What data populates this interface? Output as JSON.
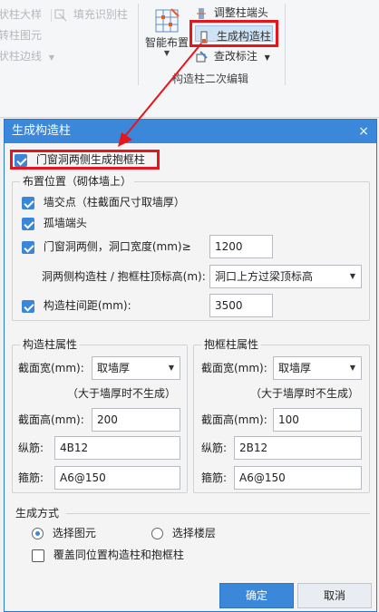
{
  "ribbon": {
    "left_items": [
      "",
      "",
      ""
    ],
    "left_item_suffixes": [
      "状柱大样",
      "转柱图元",
      "状柱边线"
    ],
    "fill_recognize": "填充识别柱",
    "smart_layout": "智能布置",
    "adjust_column_end": "调整柱端头",
    "generate_column": "生成构造柱",
    "modify_annotation": "查改标注",
    "group_label": "构造柱二次编辑"
  },
  "dialog": {
    "title": "生成构造柱",
    "close": "×",
    "door_window_frame": {
      "label": "门窗洞两侧生成抱框柱",
      "checked": true
    },
    "layout_position": {
      "legend": "布置位置（砌体墙上）",
      "wall_intersection": {
        "label": "墙交点（柱截面尺寸取墙厚）",
        "checked": true
      },
      "isolated_wall_end": {
        "label": "孤墙端头",
        "checked": true
      },
      "door_window_sides": {
        "label": "门窗洞两侧，洞口宽度(mm)≥",
        "checked": true,
        "value": "1200"
      },
      "top_elevation": {
        "label": "洞两侧构造柱 / 抱框柱顶标高(m):",
        "value": "洞口上方过梁顶标高"
      },
      "spacing": {
        "label": "构造柱间距(mm):",
        "checked": true,
        "value": "3500"
      }
    },
    "column_props": {
      "legend": "构造柱属性",
      "width_label": "截面宽(mm):",
      "width_value": "取墙厚",
      "note": "（大于墙厚时不生成）",
      "height_label": "截面高(mm):",
      "height_value": "200",
      "long_bar_label": "纵筋:",
      "long_bar_value": "4B12",
      "stirrup_label": "箍筋:",
      "stirrup_value": "A6@150"
    },
    "frame_props": {
      "legend": "抱框柱属性",
      "width_label": "截面宽(mm):",
      "width_value": "取墙厚",
      "note": "（大于墙厚时不生成）",
      "height_label": "截面高(mm):",
      "height_value": "100",
      "long_bar_label": "纵筋:",
      "long_bar_value": "2B12",
      "stirrup_label": "箍筋:",
      "stirrup_value": "A6@150"
    },
    "generate_mode": {
      "label": "生成方式",
      "select_element": "选择图元",
      "select_floor": "选择楼层",
      "selected": "选择图元",
      "overwrite": {
        "label": "覆盖同位置构造柱和抱框柱",
        "checked": false
      }
    },
    "ok": "确定",
    "cancel": "取消"
  },
  "colors": {
    "accent": "#3b87da",
    "highlight": "#e8141c"
  }
}
